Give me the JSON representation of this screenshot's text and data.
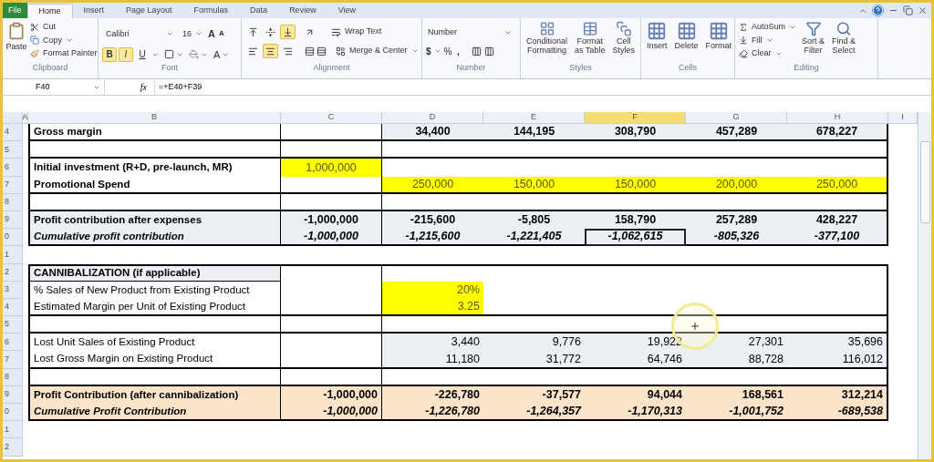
{
  "tabs": [
    {
      "label": "File",
      "kind": "backstage",
      "selected": false
    },
    {
      "label": "Home",
      "kind": "tab",
      "selected": true
    },
    {
      "label": "Insert",
      "kind": "tab",
      "selected": false
    },
    {
      "label": "Page Layout",
      "kind": "tab",
      "selected": false
    },
    {
      "label": "Formulas",
      "kind": "tab",
      "selected": false
    },
    {
      "label": "Data",
      "kind": "tab",
      "selected": false
    },
    {
      "label": "Review",
      "kind": "tab",
      "selected": false
    },
    {
      "label": "View",
      "kind": "tab",
      "selected": false
    }
  ],
  "ribbon": {
    "clipboard": {
      "label": "Clipboard",
      "paste": "Paste",
      "cut": "Cut",
      "copy": "Copy",
      "format_painter": "Format Painter"
    },
    "font": {
      "label": "Font",
      "name": "Calibri",
      "size": "16",
      "grow": "A",
      "shrink": "A",
      "text_color_button": "A",
      "styles": [
        {
          "text": "B",
          "on": true
        },
        {
          "text": "I",
          "on": true
        },
        {
          "text": "U",
          "on": false
        }
      ]
    },
    "alignment": {
      "label": "Alignment",
      "vertical": [
        {
          "on": false
        },
        {
          "on": false
        },
        {
          "on": true
        }
      ],
      "horizontal": [
        {
          "on": false
        },
        {
          "on": true
        },
        {
          "on": false
        }
      ],
      "wrap": "Wrap Text",
      "merge": "Merge & Center"
    },
    "number": {
      "label": "Number",
      "format": "Number",
      "currency": "$",
      "percent": "%",
      "comma": ","
    },
    "styles": {
      "label": "Styles",
      "buttons": [
        [
          "Conditional",
          "Formatting"
        ],
        [
          "Format",
          "as Table"
        ],
        [
          "Cell",
          "Styles"
        ]
      ]
    },
    "cells": {
      "label": "Cells",
      "buttons": [
        "Insert",
        "Delete",
        "Format"
      ]
    },
    "editing": {
      "label": "Editing",
      "small": [
        "AutoSum",
        "Fill",
        "Clear"
      ],
      "large": [
        [
          "Sort &",
          "Filter"
        ],
        [
          "Find &",
          "Select"
        ]
      ]
    }
  },
  "formula_bar": {
    "name_box": "F40",
    "function_label": "fx",
    "formula": "=+E40+F39"
  },
  "columns": [
    {
      "label": "A",
      "selected": false
    },
    {
      "label": "B",
      "selected": false
    },
    {
      "label": "C",
      "selected": false
    },
    {
      "label": "D",
      "selected": false
    },
    {
      "label": "E",
      "selected": false
    },
    {
      "label": "F",
      "selected": true
    },
    {
      "label": "G",
      "selected": false
    },
    {
      "label": "H",
      "selected": false
    },
    {
      "label": "I",
      "selected": false
    }
  ],
  "rows": [
    {
      "number": "4",
      "kind": "subtotal",
      "label": "Gross margin",
      "rule_below": true,
      "cells": [
        null,
        {
          "text": "34,400",
          "highlighted": false,
          "selected": false
        },
        {
          "text": "144,195",
          "highlighted": false,
          "selected": false
        },
        {
          "text": "308,790",
          "highlighted": false,
          "selected": false
        },
        {
          "text": "457,289",
          "highlighted": false,
          "selected": false
        },
        {
          "text": "678,227",
          "highlighted": false,
          "selected": false
        }
      ]
    },
    {
      "number": "5",
      "kind": "blank",
      "rule_below": true,
      "cells": []
    },
    {
      "number": "6",
      "kind": "input",
      "label": "Initial investment (R+D, pre-launch, MR)",
      "rule_below": false,
      "cells": [
        {
          "text": "1,000,000",
          "highlighted": true,
          "selected": false
        }
      ]
    },
    {
      "number": "7",
      "kind": "input",
      "label": "Promotional Spend",
      "rule_below": true,
      "cells": [
        null,
        {
          "text": "250,000",
          "highlighted": true,
          "selected": false
        },
        {
          "text": "150,000",
          "highlighted": true,
          "selected": false
        },
        {
          "text": "150,000",
          "highlighted": true,
          "selected": false
        },
        {
          "text": "200,000",
          "highlighted": true,
          "selected": false
        },
        {
          "text": "250,000",
          "highlighted": true,
          "selected": false
        }
      ]
    },
    {
      "number": "8",
      "kind": "blank",
      "rule_below": true,
      "cells": []
    },
    {
      "number": "9",
      "kind": "total",
      "label": "Profit contribution after expenses",
      "rule_below": false,
      "cells": [
        {
          "text": "-1,000,000",
          "highlighted": false,
          "selected": false
        },
        {
          "text": "-215,600",
          "highlighted": false,
          "selected": false
        },
        {
          "text": "-5,805",
          "highlighted": false,
          "selected": false
        },
        {
          "text": "158,790",
          "highlighted": false,
          "selected": false
        },
        {
          "text": "257,289",
          "highlighted": false,
          "selected": false
        },
        {
          "text": "428,227",
          "highlighted": false,
          "selected": false
        }
      ]
    },
    {
      "number": "0",
      "kind": "cumulative",
      "label": "Cumulative profit contribution",
      "rule_below": true,
      "cells": [
        {
          "text": "-1,000,000",
          "highlighted": false,
          "selected": false
        },
        {
          "text": "-1,215,600",
          "highlighted": false,
          "selected": false
        },
        {
          "text": "-1,221,405",
          "highlighted": false,
          "selected": false
        },
        {
          "text": "-1,062,615",
          "highlighted": false,
          "selected": true
        },
        {
          "text": "-805,326",
          "highlighted": false,
          "selected": false
        },
        {
          "text": "-377,100",
          "highlighted": false,
          "selected": false
        }
      ]
    },
    {
      "number": "1",
      "kind": "gap",
      "cells": []
    },
    {
      "number": "2",
      "kind": "heading",
      "label": "CANNIBALIZATION (if applicable)",
      "rule_below": false,
      "cells": []
    },
    {
      "number": "3",
      "kind": "assumption",
      "label": "% Sales of New Product from Existing Product",
      "rule_below": false,
      "cells": [
        null,
        {
          "text": "20%",
          "highlighted": true,
          "selected": false
        }
      ]
    },
    {
      "number": "4",
      "kind": "assumption",
      "label": "Estimated Margin per Unit of Existing Product",
      "rule_below": true,
      "cells": [
        null,
        {
          "text": "3.25",
          "highlighted": true,
          "selected": false
        }
      ]
    },
    {
      "number": "5",
      "kind": "blank",
      "rule_below": true,
      "cells": []
    },
    {
      "number": "6",
      "kind": "loss",
      "label": "Lost Unit Sales of Existing Product",
      "rule_below": false,
      "cells": [
        null,
        {
          "text": "3,440",
          "highlighted": false,
          "selected": false
        },
        {
          "text": "9,776",
          "highlighted": false,
          "selected": false
        },
        {
          "text": "19,922",
          "highlighted": false,
          "selected": false
        },
        {
          "text": "27,301",
          "highlighted": false,
          "selected": false
        },
        {
          "text": "35,696",
          "highlighted": false,
          "selected": false
        }
      ]
    },
    {
      "number": "7",
      "kind": "loss",
      "label": "Lost Gross Margin on Existing Product",
      "rule_below": true,
      "cells": [
        null,
        {
          "text": "11,180",
          "highlighted": false,
          "selected": false
        },
        {
          "text": "31,772",
          "highlighted": false,
          "selected": false
        },
        {
          "text": "64,746",
          "highlighted": false,
          "selected": false
        },
        {
          "text": "88,728",
          "highlighted": false,
          "selected": false
        },
        {
          "text": "116,012",
          "highlighted": false,
          "selected": false
        }
      ]
    },
    {
      "number": "8",
      "kind": "blank",
      "rule_below": true,
      "cells": []
    },
    {
      "number": "9",
      "kind": "net",
      "label": "Profit Contribution (after cannibalization)",
      "rule_below": false,
      "cells": [
        {
          "text": "-1,000,000",
          "highlighted": false,
          "selected": false
        },
        {
          "text": "-226,780",
          "highlighted": false,
          "selected": false
        },
        {
          "text": "-37,577",
          "highlighted": false,
          "selected": false
        },
        {
          "text": "94,044",
          "highlighted": false,
          "selected": false
        },
        {
          "text": "168,561",
          "highlighted": false,
          "selected": false
        },
        {
          "text": "312,214",
          "highlighted": false,
          "selected": false
        }
      ]
    },
    {
      "number": "0",
      "kind": "netrunning",
      "label": "Cumulative Profit Contribution",
      "rule_below": true,
      "cells": [
        {
          "text": "-1,000,000",
          "highlighted": false,
          "selected": false
        },
        {
          "text": "-1,226,780",
          "highlighted": false,
          "selected": false
        },
        {
          "text": "-1,264,357",
          "highlighted": false,
          "selected": false
        },
        {
          "text": "-1,170,313",
          "highlighted": false,
          "selected": false
        },
        {
          "text": "-1,001,752",
          "highlighted": false,
          "selected": false
        },
        {
          "text": "-689,538",
          "highlighted": false,
          "selected": false
        }
      ]
    },
    {
      "number": "1",
      "kind": "gap",
      "cells": []
    },
    {
      "number": "2",
      "kind": "gap",
      "cells": []
    }
  ]
}
